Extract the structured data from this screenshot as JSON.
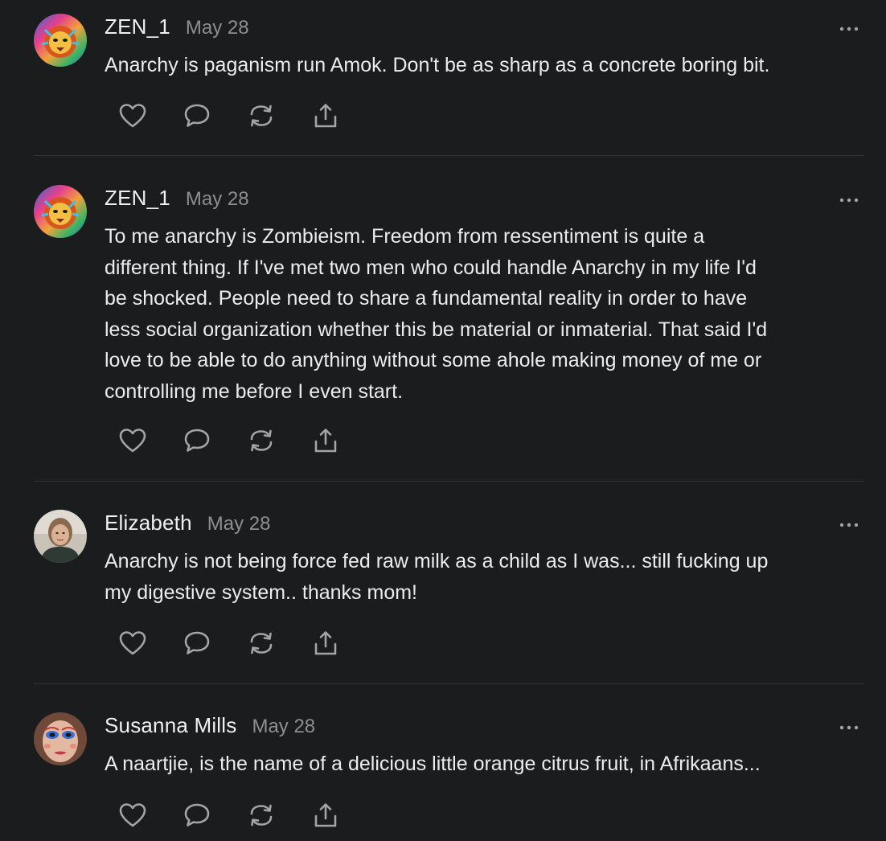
{
  "comments": [
    {
      "author": "ZEN_1",
      "date": "May 28",
      "avatar_icon": "lion-avatar",
      "text": "Anarchy is paganism run Amok. Don't be as sharp as a concrete boring bit."
    },
    {
      "author": "ZEN_1",
      "date": "May 28",
      "avatar_icon": "lion-avatar",
      "text": "To me anarchy is Zombieism. Freedom from ressentiment is quite a\ndifferent thing. If I've met two men who could handle Anarchy in my life I'd\nbe shocked. People need to share a fundamental reality in order to have\nless social organization whether this be material or inmaterial. That said I'd\nlove to be able to do anything without some ahole making money of me or\ncontrolling me before I even start."
    },
    {
      "author": "Elizabeth",
      "date": "May 28",
      "avatar_icon": "person-photo-avatar",
      "text": "Anarchy is not being force fed raw milk as a child as I was... still fucking up\nmy digestive system.. thanks mom!"
    },
    {
      "author": "Susanna Mills",
      "date": "May 28",
      "avatar_icon": "painted-face-avatar",
      "text": "A naartjie, is the name of a delicious little orange citrus fruit, in Afrikaans..."
    }
  ],
  "action_icons": [
    "heart-icon",
    "comment-bubble-icon",
    "restack-icon",
    "share-icon"
  ],
  "more_icon": "ellipsis-icon",
  "colors": {
    "background": "#1b1c1e",
    "text": "#ececec",
    "muted": "#8e8e93",
    "icon": "#a4a4a8",
    "divider": "#333438"
  }
}
